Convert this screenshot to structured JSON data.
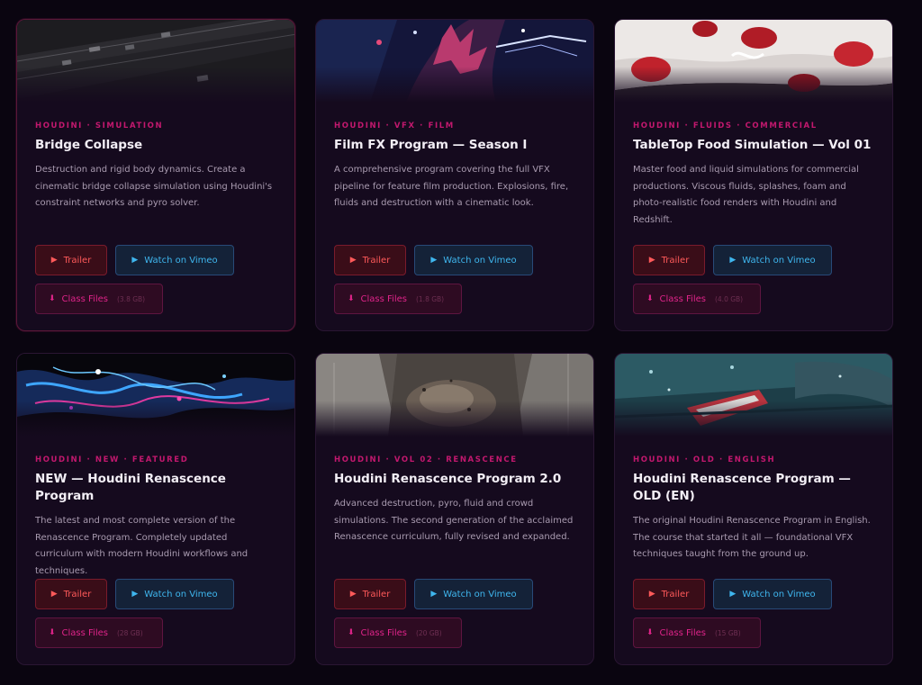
{
  "cards": [
    {
      "tags": "HOUDINI · SIMULATION",
      "title": "Bridge Collapse",
      "description": "Destruction and rigid body dynamics. Create a cinematic bridge collapse simulation using Houdini's constraint networks and pyro solver.",
      "trailer_label": "Trailer",
      "vimeo_label": "Watch on Vimeo",
      "files_label": "Class Files",
      "files_size": "(3.8 GB)",
      "trailer_icon": "play-icon",
      "vimeo_icon": "play-icon",
      "files_icon": "download-arrow-icon"
    },
    {
      "tags": "HOUDINI · VFX · FILM",
      "title": "Film FX Program — Season I",
      "description": "A comprehensive program covering the full VFX pipeline for feature film production. Explosions, fire, fluids and destruction with a cinematic look.",
      "trailer_label": "Trailer",
      "vimeo_label": "Watch on Vimeo",
      "files_label": "Class Files",
      "files_size": "(1.8 GB)",
      "trailer_icon": "play-icon",
      "vimeo_icon": "play-icon",
      "files_icon": "download-arrow-icon"
    },
    {
      "tags": "HOUDINI · FLUIDS · COMMERCIAL",
      "title": "TableTop Food Simulation — Vol 01",
      "description": "Master food and liquid simulations for commercial productions. Viscous fluids, splashes, foam and photo-realistic food renders with Houdini and Redshift.",
      "trailer_label": "Trailer",
      "vimeo_label": "Watch on Vimeo",
      "files_label": "Class Files",
      "files_size": "(4.0 GB)",
      "trailer_icon": "play-icon",
      "vimeo_icon": "play-icon",
      "files_icon": "download-arrow-icon"
    },
    {
      "tags": "HOUDINI · NEW · FEATURED",
      "title": "NEW — Houdini Renascence Program",
      "description": "The latest and most complete version of the Renascence Program. Completely updated curriculum with modern Houdini workflows and techniques.",
      "trailer_label": "Trailer",
      "vimeo_label": "Watch on Vimeo",
      "files_label": "Class Files",
      "files_size": "(28 GB)",
      "trailer_icon": "play-icon",
      "vimeo_icon": "play-icon",
      "files_icon": "download-arrow-icon"
    },
    {
      "tags": "HOUDINI · VOL 02 · RENASCENCE",
      "title": "Houdini Renascence Program 2.0",
      "description": "Advanced destruction, pyro, fluid and crowd simulations. The second generation of the acclaimed Renascence curriculum, fully revised and expanded.",
      "trailer_label": "Trailer",
      "vimeo_label": "Watch on Vimeo",
      "files_label": "Class Files",
      "files_size": "(20 GB)",
      "trailer_icon": "play-icon",
      "vimeo_icon": "play-icon",
      "files_icon": "download-arrow-icon"
    },
    {
      "tags": "HOUDINI · OLD · ENGLISH",
      "title": "Houdini Renascence Program — OLD (EN)",
      "description": "The original Houdini Renascence Program in English. The course that started it all — foundational VFX techniques taught from the ground up.",
      "trailer_label": "Trailer",
      "vimeo_label": "Watch on Vimeo",
      "files_label": "Class Files",
      "files_size": "(15 GB)",
      "trailer_icon": "play-icon",
      "vimeo_icon": "play-icon",
      "files_icon": "download-arrow-icon"
    }
  ],
  "colors": {
    "page_bg": "#0a0510",
    "card_bg": "#150a1e",
    "tag": "#c2186e",
    "trailer": "#ff5a5a",
    "vimeo": "#3fb6ee",
    "files": "#e0248a"
  }
}
